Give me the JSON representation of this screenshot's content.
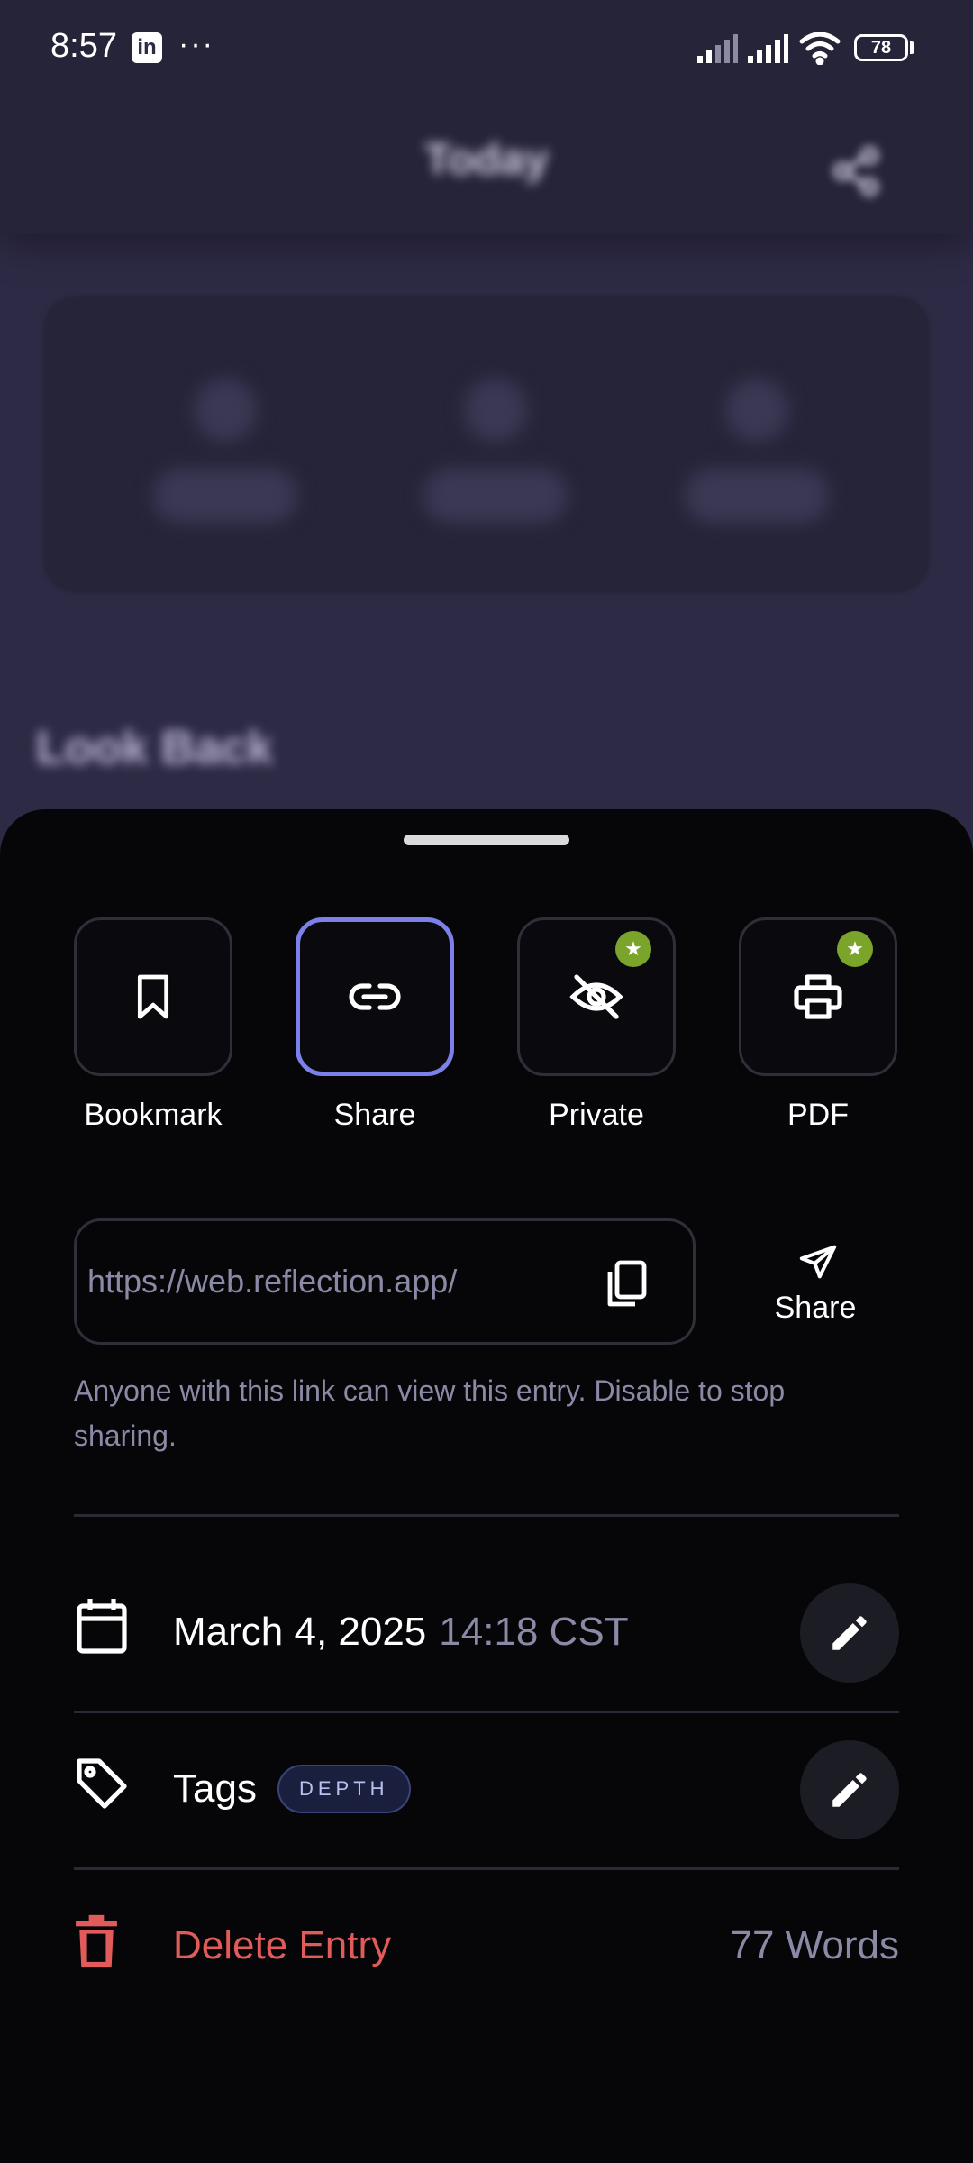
{
  "status_bar": {
    "time": "8:57",
    "battery": "78",
    "app_badge": "in",
    "more": "···"
  },
  "background": {
    "title": "Today",
    "section_title": "Look Back"
  },
  "actions": [
    {
      "label": "Bookmark",
      "icon": "bookmark-icon",
      "active": false,
      "premium": false
    },
    {
      "label": "Share",
      "icon": "link-icon",
      "active": true,
      "premium": false
    },
    {
      "label": "Private",
      "icon": "eye-off-icon",
      "active": false,
      "premium": true
    },
    {
      "label": "PDF",
      "icon": "printer-icon",
      "active": false,
      "premium": true
    }
  ],
  "share": {
    "url": "https://web.reflection.app/",
    "button_label": "Share",
    "help_text": "Anyone with this link can view this entry. Disable to stop sharing."
  },
  "entry": {
    "date": "March 4, 2025",
    "time": "14:18 CST",
    "tags_label": "Tags",
    "tag": "DEPTH",
    "delete_label": "Delete Entry",
    "word_count": "77 Words"
  },
  "colors": {
    "accent": "#7b80ea",
    "premium_badge": "#7aa52a",
    "danger": "#e25b5b",
    "muted_text": "#8b8aa6"
  }
}
